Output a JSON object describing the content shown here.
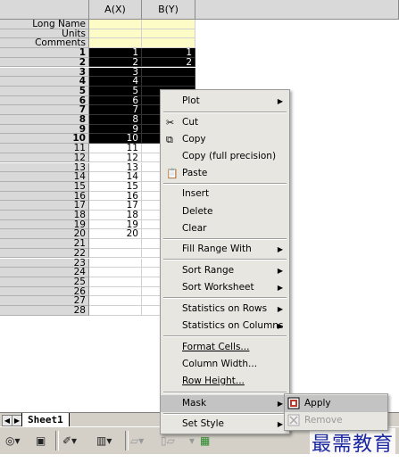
{
  "spreadsheet": {
    "columns": [
      "A(X)",
      "B(Y)"
    ],
    "meta_rows": [
      "Long Name",
      "Units",
      "Comments"
    ],
    "row_numbers": [
      "1",
      "2",
      "3",
      "4",
      "5",
      "6",
      "7",
      "8",
      "9",
      "10",
      "11",
      "12",
      "13",
      "14",
      "15",
      "16",
      "17",
      "18",
      "19",
      "20",
      "21",
      "22",
      "23",
      "24",
      "25",
      "26",
      "27",
      "28"
    ],
    "col_a": [
      "1",
      "2",
      "3",
      "4",
      "5",
      "6",
      "7",
      "8",
      "9",
      "10",
      "11",
      "12",
      "13",
      "14",
      "15",
      "16",
      "17",
      "18",
      "19",
      "20"
    ],
    "col_b": [
      "1",
      "2"
    ],
    "sheet_tab": "Sheet1",
    "tab_prev_glyph": "◀",
    "tab_next_glyph": "▶"
  },
  "context_menu": {
    "items": [
      {
        "label": "Plot",
        "submenu": true
      },
      {
        "label": "Cut",
        "icon": "scissors-icon"
      },
      {
        "label": "Copy",
        "icon": "copy-icon"
      },
      {
        "label": "Copy (full precision)"
      },
      {
        "label": "Paste",
        "icon": "paste-icon"
      },
      {
        "label": "Insert"
      },
      {
        "label": "Delete"
      },
      {
        "label": "Clear"
      },
      {
        "label": "Fill Range With",
        "submenu": true
      },
      {
        "label": "Sort Range",
        "submenu": true
      },
      {
        "label": "Sort Worksheet",
        "submenu": true
      },
      {
        "label": "Statistics on Rows",
        "submenu": true
      },
      {
        "label": "Statistics on Columns",
        "submenu": true
      },
      {
        "label": "Format Cells..."
      },
      {
        "label": "Column Width..."
      },
      {
        "label": "Row Height..."
      },
      {
        "label": "Mask",
        "submenu": true,
        "highlighted": true
      },
      {
        "label": "Set Style",
        "submenu": true
      }
    ],
    "arrow_glyph": "▶"
  },
  "mask_submenu": {
    "items": [
      {
        "label": "Apply",
        "icon": "mask-apply-icon",
        "highlighted": true
      },
      {
        "label": "Remove",
        "icon": "mask-remove-icon",
        "disabled": true
      }
    ]
  },
  "toolbar": {
    "watermark": "最需教育"
  },
  "colors": {
    "meta_cell": "#fdfbc6",
    "selection": "#000000",
    "menu_bg": "#e8e6e1",
    "menu_highlight": "#c3c3c3",
    "watermark": "#1a27a0"
  }
}
